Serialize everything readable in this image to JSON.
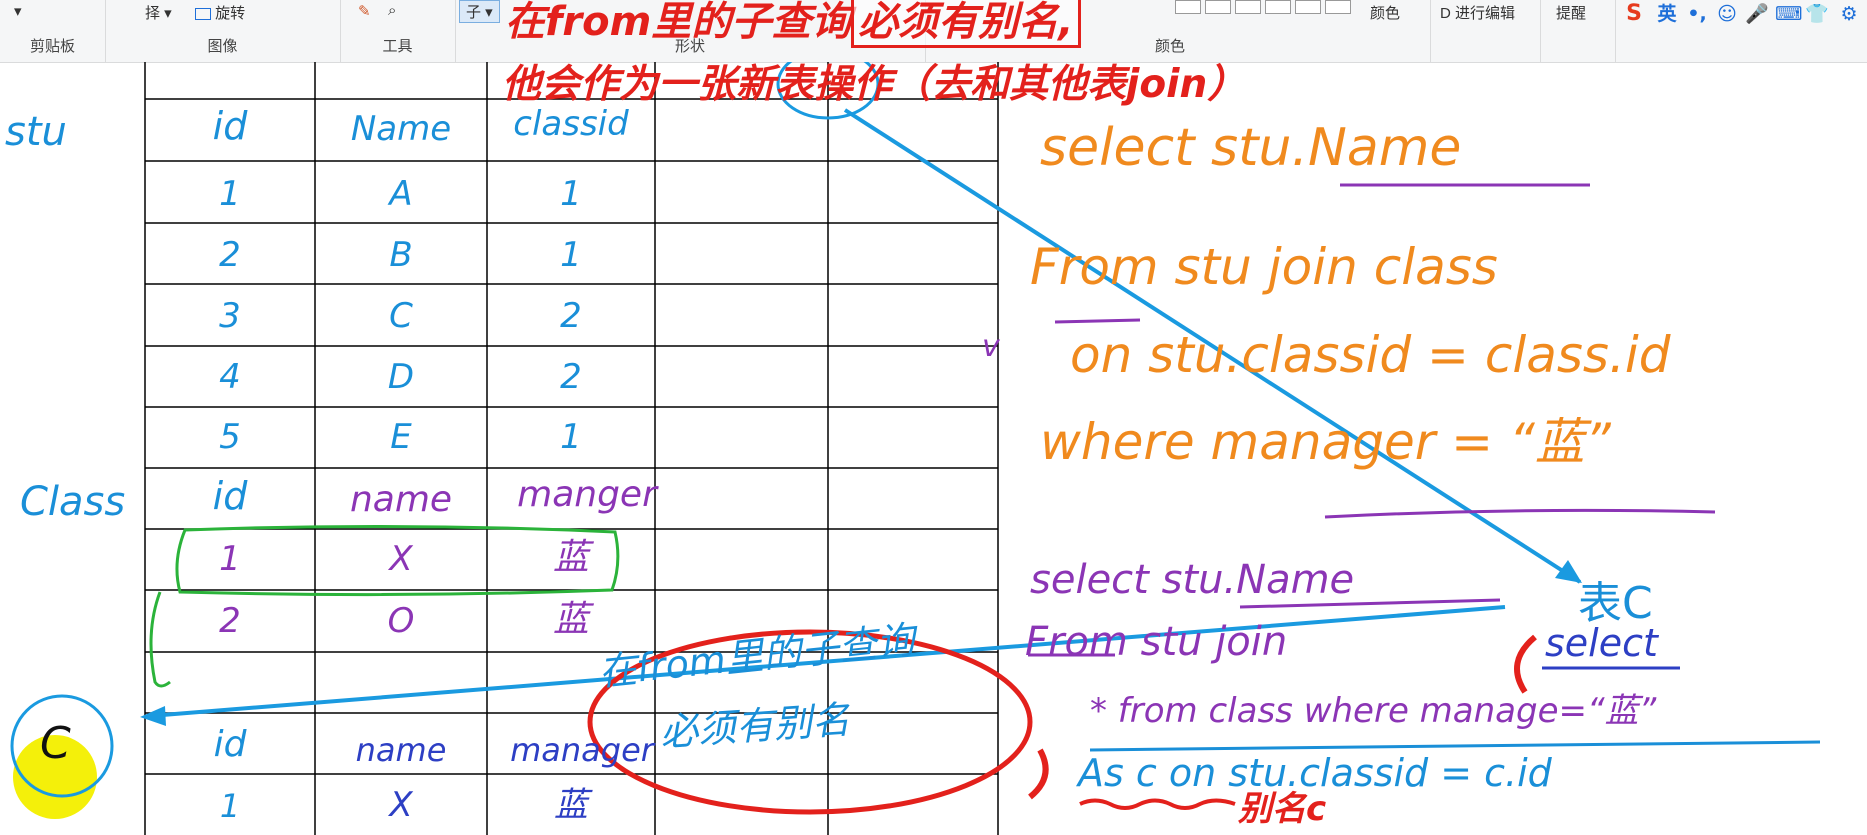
{
  "ribbon": {
    "select_label": "择",
    "rotate_label": "旋转",
    "subitem_label": "子",
    "groups": {
      "clipboard": "剪贴板",
      "image": "图像",
      "tools": "工具",
      "shapes": "形状",
      "colors": "颜色"
    },
    "color_label": "颜色",
    "edit3d_label": "D 进行编辑",
    "remind_label": "提醒"
  },
  "tray": {
    "ime_logo": "S",
    "ime_lang": "英"
  },
  "captions": {
    "line1_prefix": "在from里的子查询",
    "line1_boxed": "必须有别名,",
    "line2": "他会作为一张新表操作（去和其他表join）"
  },
  "stu_table": {
    "label": "stu",
    "headers": [
      "id",
      "Name",
      "classid"
    ],
    "rows": [
      [
        "1",
        "A",
        "1"
      ],
      [
        "2",
        "B",
        "1"
      ],
      [
        "3",
        "C",
        "2"
      ],
      [
        "4",
        "D",
        "2"
      ],
      [
        "5",
        "E",
        "1"
      ]
    ]
  },
  "class_table": {
    "label": "Class",
    "headers": [
      "id",
      "name",
      "manger"
    ],
    "rows": [
      [
        "1",
        "X",
        "蓝"
      ],
      [
        "2",
        "O",
        "蓝"
      ]
    ]
  },
  "c_table": {
    "label": "C",
    "headers": [
      "id",
      "name",
      "manager"
    ],
    "rows": [
      [
        "1",
        "X",
        "蓝"
      ]
    ]
  },
  "query1": {
    "line1": "select  stu.Name",
    "line2": "From stu join class",
    "line3": "on stu.classid = class.id",
    "line4": "where  manager = “蓝”"
  },
  "query2": {
    "line1": "select  stu.Name",
    "line2": "From  stu  join",
    "subquery_keyword": "select",
    "line3": "* from class where manage=“蓝”",
    "line4": "As  c  on  stu.classid = c.id"
  },
  "annotations": {
    "table_c": "表C",
    "alias_c": "别名c",
    "circle_note_line1": "在from里的子查询",
    "circle_note_line2": "必须有别名"
  },
  "stray_mark": "v"
}
